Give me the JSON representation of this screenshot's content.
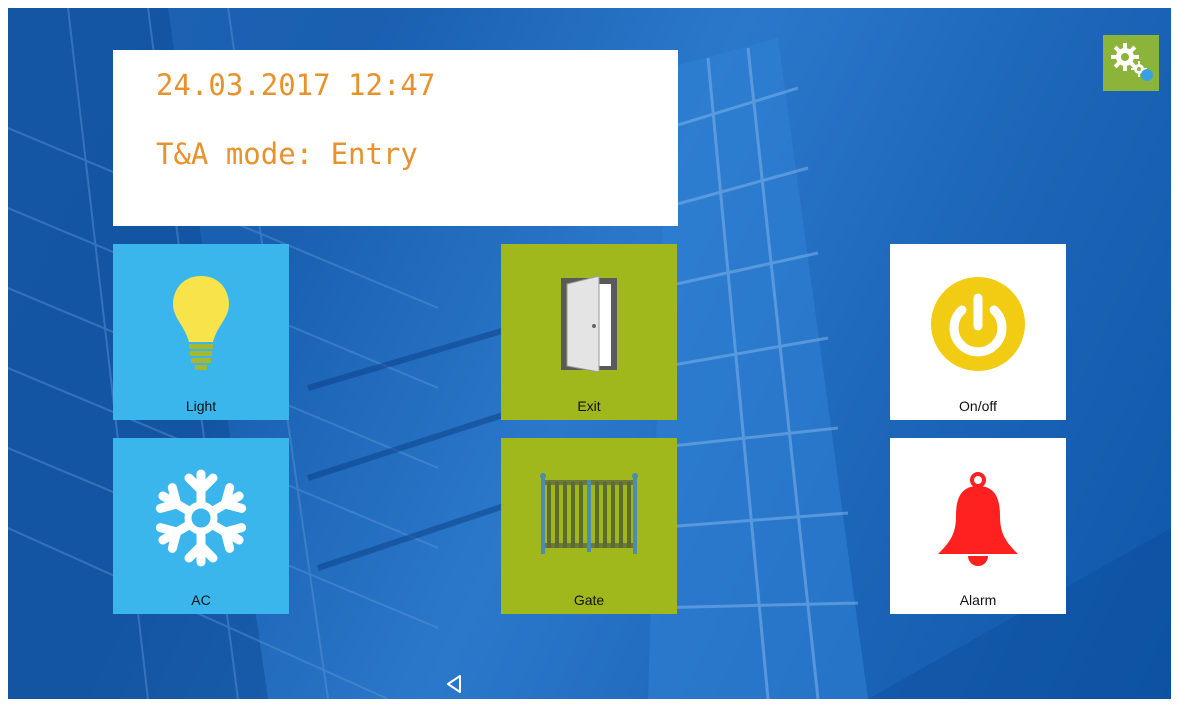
{
  "status_panel": {
    "datetime": "24.03.2017 12:47",
    "mode": "T&A mode: Entry"
  },
  "settings": {
    "icon": "gears-icon",
    "color": "#8db43a"
  },
  "tiles": [
    {
      "id": "light",
      "label": "Light",
      "icon": "lightbulb-icon",
      "color": "#3bb6ec"
    },
    {
      "id": "exit",
      "label": "Exit",
      "icon": "open-door-icon",
      "color": "#a1b81d"
    },
    {
      "id": "onoff",
      "label": "On/off",
      "icon": "power-icon",
      "color": "#ffffff"
    },
    {
      "id": "ac",
      "label": "AC",
      "icon": "snowflake-icon",
      "color": "#3bb6ec"
    },
    {
      "id": "gate",
      "label": "Gate",
      "icon": "gate-icon",
      "color": "#a1b81d"
    },
    {
      "id": "alarm",
      "label": "Alarm",
      "icon": "bell-icon",
      "color": "#ffffff"
    }
  ],
  "navigation": {
    "back_icon": "back-triangle-icon"
  },
  "colors": {
    "info_text": "#e8922e",
    "background": "#1d63b4"
  }
}
